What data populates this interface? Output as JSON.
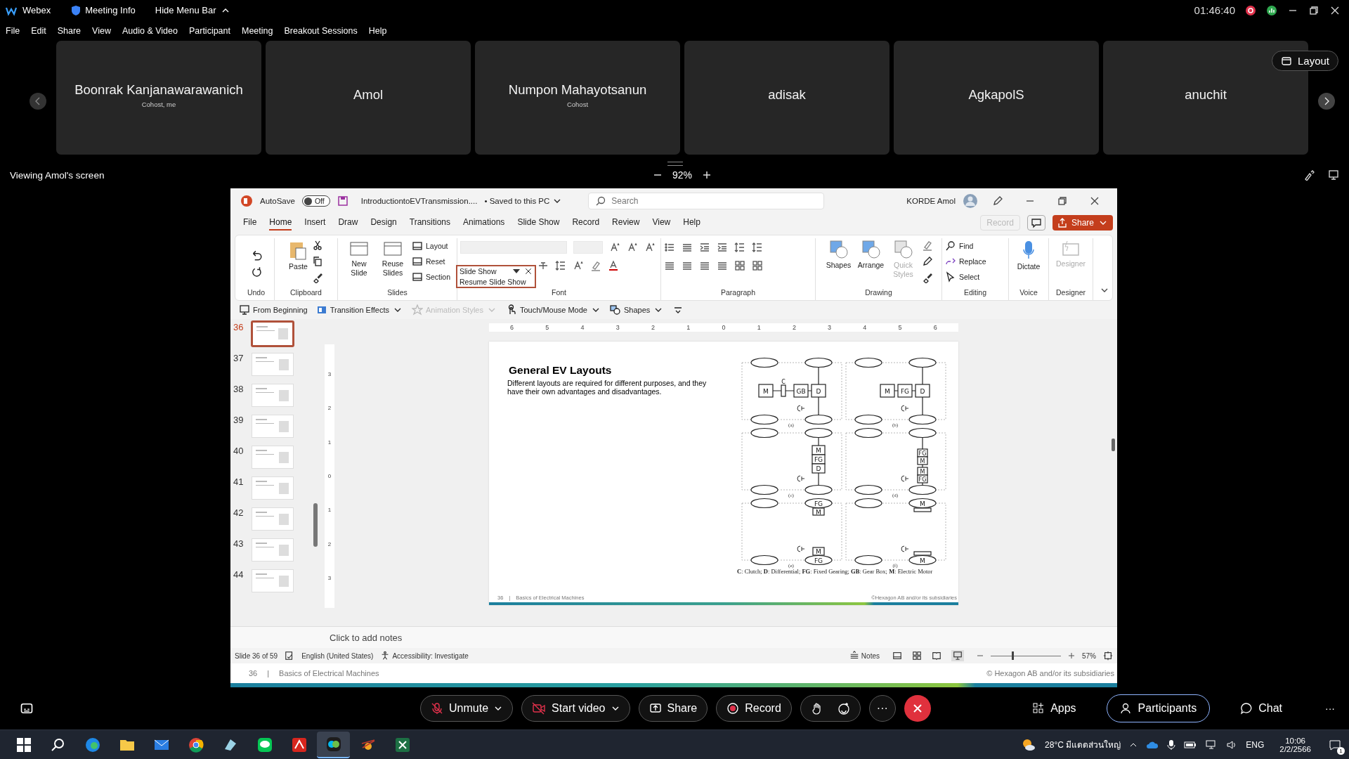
{
  "webex": {
    "app": "Webex",
    "meeting_info": "Meeting Info",
    "hide_menu": "Hide Menu Bar",
    "clock": "01:46:40",
    "menu": [
      "File",
      "Edit",
      "Share",
      "View",
      "Audio & Video",
      "Participant",
      "Meeting",
      "Breakout Sessions",
      "Help"
    ],
    "layout_button": "Layout",
    "participants": [
      {
        "name": "Boonrak Kanjanawarawanich",
        "role": "Cohost, me"
      },
      {
        "name": "Amol"
      },
      {
        "name": "Numpon Mahayotsanun",
        "role": "Cohost"
      },
      {
        "name": "adisak"
      },
      {
        "name": "AgkapolS"
      },
      {
        "name": "anuchit"
      }
    ],
    "viewing": "Viewing Amol's screen",
    "zoom": "92%"
  },
  "powerpoint": {
    "autosave": "AutoSave",
    "autosave_toggle": {
      "label": "Off",
      "on": false
    },
    "filename": "IntroductiontoEVTransmission....",
    "saved": "• Saved to this PC",
    "search": {
      "placeholder": "Search"
    },
    "user": "KORDE Amol",
    "tabs": [
      {
        "label": "File",
        "selected": false
      },
      {
        "label": "Home",
        "selected": true
      },
      {
        "label": "Insert",
        "selected": false
      },
      {
        "label": "Draw",
        "selected": false
      },
      {
        "label": "Design",
        "selected": false
      },
      {
        "label": "Transitions",
        "selected": false
      },
      {
        "label": "Animations",
        "selected": false
      },
      {
        "label": "Slide Show",
        "selected": false
      },
      {
        "label": "Record",
        "selected": false
      },
      {
        "label": "Review",
        "selected": false
      },
      {
        "label": "View",
        "selected": false
      },
      {
        "label": "Help",
        "selected": false
      }
    ],
    "record_button": {
      "label": "Record",
      "disabled": true
    },
    "share_button": "Share",
    "ribbon": {
      "undo": "Undo",
      "clipboard": {
        "label": "Clipboard",
        "paste": "Paste"
      },
      "slides": {
        "label": "Slides",
        "buttons": [
          "New Slide",
          "Reuse Slides"
        ],
        "small": [
          "Layout",
          "Reset",
          "Section"
        ]
      },
      "font": "Font",
      "paragraph": "Paragraph",
      "drawing": {
        "label": "Drawing",
        "buttons": [
          {
            "label": "Shapes",
            "disabled": false
          },
          {
            "label": "Arrange",
            "disabled": false
          },
          {
            "label": "Quick Styles",
            "disabled": true
          }
        ]
      },
      "editing": {
        "label": "Editing",
        "items": [
          "Find",
          "Replace",
          "Select"
        ]
      },
      "voice": {
        "label": "Voice",
        "button": "Dictate"
      },
      "designer": {
        "label": "Designer",
        "button": "Designer",
        "disabled": true
      }
    },
    "slideshow_popup": {
      "title": "Slide Show",
      "item": "Resume Slide Show"
    },
    "toolbar": [
      {
        "label": "From Beginning",
        "kind": "start",
        "disabled": false
      },
      {
        "label": "Transition Effects",
        "kind": "transition",
        "disabled": false
      },
      {
        "label": "Animation Styles",
        "kind": "animation",
        "disabled": true
      },
      {
        "label": "Touch/Mouse Mode",
        "kind": "touch",
        "disabled": false
      },
      {
        "label": "Shapes",
        "kind": "shapes",
        "disabled": false
      }
    ],
    "thumbnails": [
      {
        "number": "36",
        "selected": true
      },
      {
        "number": "37",
        "selected": false
      },
      {
        "number": "38",
        "selected": false
      },
      {
        "number": "39",
        "selected": false
      },
      {
        "number": "40",
        "selected": false
      },
      {
        "number": "41",
        "selected": false
      },
      {
        "number": "42",
        "selected": false
      },
      {
        "number": "43",
        "selected": false
      },
      {
        "number": "44",
        "selected": false
      }
    ],
    "h_ruler": [
      "6",
      "5",
      "4",
      "3",
      "2",
      "1",
      "0",
      "1",
      "2",
      "3",
      "4",
      "5",
      "6"
    ],
    "v_ruler": [
      "3",
      "2",
      "1",
      "0",
      "1",
      "2",
      "3"
    ],
    "slide": {
      "title": "General EV Layouts",
      "body": "Different layouts are required for different purposes, and they have their own advantages and disadvantages.",
      "panels": [
        {
          "caption": "(a)",
          "kind": "chain",
          "parts": [
            "M",
            "C",
            "GB",
            "D"
          ]
        },
        {
          "caption": "(b)",
          "kind": "chain",
          "parts": [
            "M",
            "FG",
            "D"
          ]
        },
        {
          "caption": "(c)",
          "kind": "stack",
          "parts": [
            "M",
            "FG",
            "D"
          ]
        },
        {
          "caption": "(d)",
          "kind": "split",
          "front": [
            "FG",
            "M"
          ],
          "rear": [
            "M",
            "FG"
          ]
        },
        {
          "caption": "(e)",
          "kind": "wheel",
          "front_wheel": "FG",
          "front_box": "M",
          "rear_box": "M",
          "rear_wheel": "FG"
        },
        {
          "caption": "(f)",
          "kind": "wheel",
          "front_wheel": "M",
          "rear_wheel": "M"
        }
      ],
      "legend": "**C**: Clutch; **D**: Differential; **FG**: Fixed Gearing; **GB**: Gear Box; **M**: Electric Motor",
      "footer_number": "36",
      "footer_sep": "|",
      "footer_title": "Basics of Electrical Machines",
      "footer_copyright": "©Hexagon AB and/or its subsidiaries"
    },
    "notes_placeholder": "Click to add notes",
    "status": {
      "slide": "Slide 36 of 59",
      "language": "English (United States)",
      "accessibility": "Accessibility: Investigate",
      "notes": "Notes",
      "zoom": "57%",
      "zoom_slider": {
        "level": 0.3
      }
    },
    "background_footer": {
      "number": "36",
      "sep": "|",
      "title": "Basics of Electrical Machines",
      "copyright": "© Hexagon AB and/or its subsidiaries"
    }
  },
  "controls": [
    {
      "label": "Unmute",
      "kind": "mic"
    },
    {
      "label": "Start video",
      "kind": "video"
    },
    {
      "label": "Share",
      "kind": "share"
    },
    {
      "label": "Record",
      "kind": "record"
    }
  ],
  "more": "···",
  "right_controls": [
    {
      "label": "Apps",
      "kind": "apps",
      "selected": false
    },
    {
      "label": "Participants",
      "kind": "people",
      "selected": true
    },
    {
      "label": "Chat",
      "kind": "chat",
      "selected": false
    }
  ],
  "right_more": "···",
  "taskbar": {
    "apps": [
      {
        "kind": "start",
        "selected": false
      },
      {
        "kind": "search",
        "selected": false
      },
      {
        "kind": "edge",
        "selected": false
      },
      {
        "kind": "folder",
        "selected": false
      },
      {
        "kind": "mail",
        "selected": false
      },
      {
        "kind": "chrome",
        "selected": false
      },
      {
        "kind": "app",
        "selected": false
      },
      {
        "kind": "line",
        "selected": false
      },
      {
        "kind": "acrobat",
        "selected": false
      },
      {
        "kind": "webex",
        "selected": true
      },
      {
        "kind": "sun",
        "selected": false
      },
      {
        "kind": "excel",
        "selected": false
      }
    ],
    "weather": "28°C มีแดดส่วนใหญ่",
    "lang": "ENG",
    "time": "10:06",
    "date": "2/2/2566",
    "notifications": "1"
  }
}
